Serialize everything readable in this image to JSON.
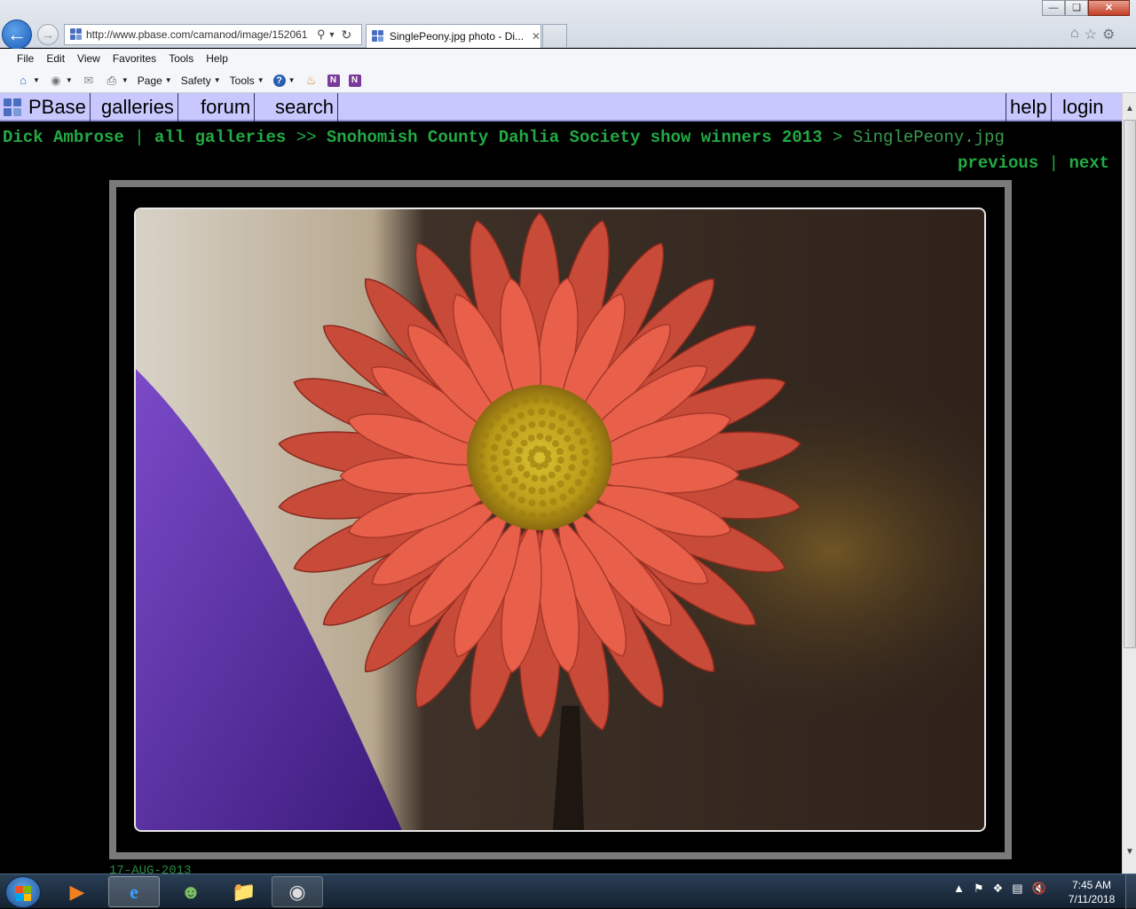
{
  "browser": {
    "address_url": "http://www.pbase.com/camanod/image/152061",
    "address_domain": "pbase.com",
    "tab_title": "SinglePeony.jpg photo - Di...",
    "menu": [
      "File",
      "Edit",
      "View",
      "Favorites",
      "Tools",
      "Help"
    ],
    "commands": {
      "page": "Page",
      "safety": "Safety",
      "tools": "Tools"
    }
  },
  "site_nav": {
    "logo_text": "PBase",
    "items": [
      "galleries",
      "forum",
      "search"
    ],
    "right_items": [
      "help",
      "login"
    ]
  },
  "breadcrumb": {
    "owner": "Dick Ambrose",
    "sep1": "|",
    "all_galleries": "all galleries",
    "sep2": ">>",
    "gallery": "Snohomish County Dahlia Society show winners 2013",
    "sep3": ">",
    "current": "SinglePeony.jpg"
  },
  "pager": {
    "previous": "previous",
    "sep": "|",
    "next": "next"
  },
  "photo": {
    "date": "17-AUG-2013"
  },
  "taskbar": {
    "time": "7:45 AM",
    "date": "7/11/2018"
  },
  "colors": {
    "link_green": "#22aa44",
    "nav_bg": "#c8c8ff",
    "frame_gray": "#7a7a7a",
    "petal": "#e8604a"
  }
}
